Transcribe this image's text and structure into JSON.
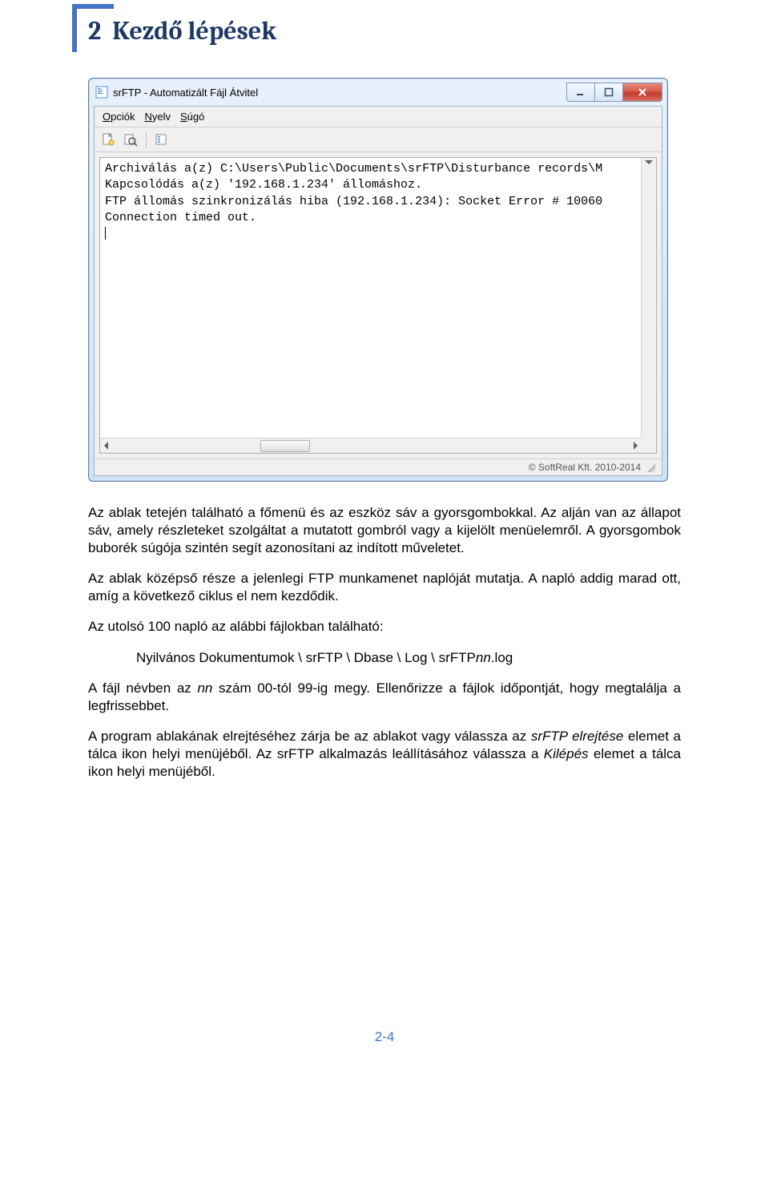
{
  "section": {
    "number": "2",
    "title": "Kezdő lépések"
  },
  "window": {
    "title": "srFTP - Automatizált Fájl Átvitel",
    "menus": {
      "options": "Opciók",
      "language": "Nyelv",
      "help": "Súgó"
    },
    "log": {
      "line1": "Archiválás a(z) C:\\Users\\Public\\Documents\\srFTP\\Disturbance records\\M",
      "line2": "Kapcsolódás a(z) '192.168.1.234' állomáshoz.",
      "line3": "FTP állomás szinkronizálás hiba (192.168.1.234): Socket Error # 10060",
      "line4": "Connection timed out."
    },
    "status": "© SoftReal Kft. 2010-2014"
  },
  "body": {
    "p1": "Az ablak tetején található a főmenü és az eszköz sáv a gyorsgombokkal. Az alján van az állapot sáv, amely részleteket szolgáltat a mutatott gombról vagy a kijelölt menüelemről. A gyorsgombok buborék súgója szintén segít azonosítani az indított műveletet.",
    "p2": "Az ablak középső része a jelenlegi FTP munkamenet naplóját mutatja. A napló addig marad ott, amíg a következő ciklus el nem kezdődik.",
    "p3": "Az utolsó 100 napló az alábbi fájlokban található:",
    "path_prefix": "Nyilvános Dokumentumok \\ srFTP \\ Dbase \\ Log \\ srFTP",
    "path_nn": "nn",
    "path_suffix": ".log",
    "p5a": "A fájl névben az ",
    "p5_nn": "nn",
    "p5b": " szám 00-tól 99-ig megy. Ellenőrizze a fájlok időpontját, hogy megtalálja a legfrissebbet.",
    "p6a": "A program ablakának elrejtéséhez zárja be az ablakot vagy válassza az ",
    "p6_hide": "srFTP elrejtése",
    "p6b": " elemet a tálca ikon helyi menüjéből. Az srFTP alkalmazás leállításához válassza a ",
    "p6_exit": "Kilépés",
    "p6c": " elemet a tálca ikon helyi menüjéből."
  },
  "pagenum": "2-4"
}
